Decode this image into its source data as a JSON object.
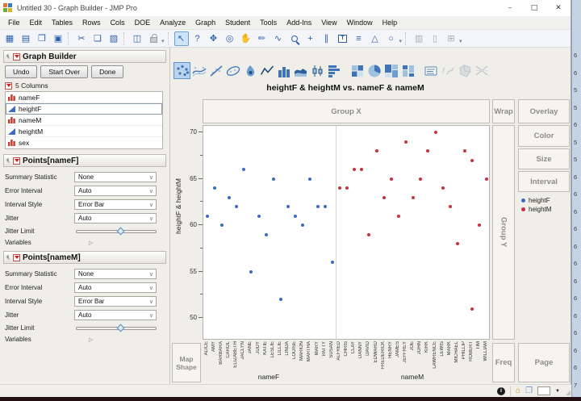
{
  "window": {
    "title": "Untitled 30 - Graph Builder - JMP Pro",
    "controls": [
      {
        "name": "minimize-button",
        "glyph": "–"
      },
      {
        "name": "maximize-button",
        "glyph": "□"
      },
      {
        "name": "close-button",
        "glyph": "✕"
      }
    ]
  },
  "menu": {
    "items": [
      "File",
      "Edit",
      "Tables",
      "Rows",
      "Cols",
      "DOE",
      "Analyze",
      "Graph",
      "Student",
      "Tools",
      "Add-Ins",
      "View",
      "Window",
      "Help"
    ]
  },
  "toolbar": {
    "groups": [
      [
        {
          "name": "new-data-table-icon",
          "glyph": "▦"
        },
        {
          "name": "new-journal-icon",
          "glyph": "▤"
        },
        {
          "name": "open-icon",
          "glyph": "❐"
        },
        {
          "name": "save-icon",
          "glyph": "▣"
        }
      ],
      [
        {
          "name": "cut-icon",
          "glyph": "✂"
        },
        {
          "name": "copy-icon",
          "glyph": "❏"
        },
        {
          "name": "paste-icon",
          "glyph": "▨"
        }
      ],
      [
        {
          "name": "script-window-icon",
          "glyph": "◫"
        },
        {
          "name": "lock-icon",
          "glyph": "",
          "css": "lock",
          "gray": true
        }
      ],
      [
        {
          "name": "arrow-tool-icon",
          "glyph": "↖",
          "selected": true
        },
        {
          "name": "help-tool-icon",
          "glyph": "?"
        },
        {
          "name": "grabber-tool-icon",
          "glyph": "✥"
        },
        {
          "name": "brush-tool-icon",
          "glyph": "◎"
        },
        {
          "name": "hand-tool-icon",
          "glyph": "✋"
        },
        {
          "name": "paintbrush-tool-icon",
          "glyph": "✏"
        },
        {
          "name": "lasso-tool-icon",
          "glyph": "∿"
        },
        {
          "name": "magnifier-tool-icon",
          "glyph": "",
          "css": "magnifier"
        },
        {
          "name": "crosshair-tool-icon",
          "glyph": "+"
        },
        {
          "name": "scroller-tool-icon",
          "glyph": "∥"
        },
        {
          "name": "annotate-tool-icon",
          "glyph": "T",
          "css": "annotate"
        },
        {
          "name": "line-annotate-tool-icon",
          "glyph": "≡"
        },
        {
          "name": "polygon-annotate-tool-icon",
          "glyph": "△"
        },
        {
          "name": "oval-annotate-tool-icon",
          "glyph": "○"
        }
      ],
      [
        {
          "name": "save-session-icon",
          "glyph": "▥",
          "gray": true
        },
        {
          "name": "columns-viewer-icon",
          "glyph": "▯",
          "gray": true
        },
        {
          "name": "add-icon",
          "glyph": "⊞",
          "gray": true
        }
      ]
    ]
  },
  "left_panel": {
    "header": "Graph Builder",
    "buttons": [
      {
        "name": "undo-button",
        "label": "Undo"
      },
      {
        "name": "start-over-button",
        "label": "Start Over"
      },
      {
        "name": "done-button",
        "label": "Done"
      }
    ],
    "columns_header": "5 Columns",
    "columns": [
      {
        "name": "nameF",
        "type": "nominal",
        "selected": false
      },
      {
        "name": "heightF",
        "type": "continuous",
        "selected": true
      },
      {
        "name": "nameM",
        "type": "nominal",
        "selected": false
      },
      {
        "name": "heightM",
        "type": "continuous",
        "selected": false
      },
      {
        "name": "sex",
        "type": "nominal",
        "selected": false
      }
    ],
    "panels": [
      {
        "title": "Points[nameF]",
        "rows": [
          {
            "label": "Summary Statistic",
            "value": "None"
          },
          {
            "label": "Error Interval",
            "value": "Auto"
          },
          {
            "label": "Interval Style",
            "value": "Error Bar"
          },
          {
            "label": "Jitter",
            "value": "Auto"
          }
        ],
        "slider_label": "Jitter Limit",
        "variables_label": "Variables"
      },
      {
        "title": "Points[nameM]",
        "rows": [
          {
            "label": "Summary Statistic",
            "value": "None"
          },
          {
            "label": "Error Interval",
            "value": "Auto"
          },
          {
            "label": "Interval Style",
            "value": "Error Bar"
          },
          {
            "label": "Jitter",
            "value": "Auto"
          }
        ],
        "slider_label": "Jitter Limit",
        "variables_label": "Variables"
      }
    ]
  },
  "gallery": {
    "items": [
      {
        "name": "points",
        "selected": true
      },
      {
        "name": "smoother"
      },
      {
        "name": "line-of-fit"
      },
      {
        "name": "ellipse"
      },
      {
        "name": "contour"
      },
      {
        "name": "line"
      },
      {
        "name": "bar"
      },
      {
        "name": "area"
      },
      {
        "name": "box-plot"
      },
      {
        "name": "histogram"
      },
      {
        "name": "heatmap",
        "gap_before": true
      },
      {
        "name": "pie"
      },
      {
        "name": "treemap"
      },
      {
        "name": "mosaic"
      },
      {
        "name": "caption-box",
        "gap_before": true
      },
      {
        "name": "formula",
        "disabled": true
      },
      {
        "name": "map-shapes",
        "disabled": true
      },
      {
        "name": "parallel",
        "disabled": true
      }
    ]
  },
  "chart": {
    "title": "heightF & heightM vs. nameF & nameM",
    "zones": {
      "group_x": "Group X",
      "wrap": "Wrap",
      "overlay": "Overlay",
      "color": "Color",
      "size": "Size",
      "interval": "Interval",
      "group_y": "Group Y",
      "map_shape": "Map Shape",
      "freq": "Freq",
      "page": "Page"
    },
    "legend": [
      {
        "label": "heightF",
        "color": "#3a6bc6"
      },
      {
        "label": "heightM",
        "color": "#c9313f"
      }
    ]
  },
  "chart_data": {
    "type": "scatter",
    "title": "heightF & heightM vs. nameF & nameM",
    "ylabel": "heightF & heightM",
    "yticks": [
      50,
      55,
      60,
      65,
      70
    ],
    "ylim": [
      49,
      71
    ],
    "x_groups": [
      {
        "xlabel": "nameF",
        "series": "heightF",
        "color": "#3a6bc6",
        "categories": [
          "ALICE",
          "AMY",
          "BARBARA",
          "CAROL",
          "ELIZABETH",
          "JACLYN",
          "JANE",
          "JUDY",
          "KATIE",
          "LESLIE",
          "LILLIE",
          "LINDA",
          "LOUISE",
          "MARION",
          "MARTHA",
          "MARY",
          "PATTY",
          "SUSAN"
        ],
        "values": [
          61,
          64,
          60,
          63,
          62,
          66,
          55,
          61,
          59,
          65,
          52,
          62,
          61,
          60,
          65,
          62,
          62,
          56
        ]
      },
      {
        "xlabel": "nameM",
        "series": "heightM",
        "color": "#c9313f",
        "categories": [
          "ALFRED",
          "CHRIS",
          "CLAY",
          "DANNY",
          "DAVID",
          "EDWARD",
          "FREDERICK",
          "HENRY",
          "JAMES",
          "JEFFREY",
          "JOE",
          "JOHN",
          "KIRK",
          "LAWRENCE",
          "LEWIS",
          "MARK",
          "MICHAEL",
          "PHILLIP",
          "ROBERT",
          "TIM",
          "WILLIAM"
        ],
        "values": [
          64,
          64,
          66,
          66,
          59,
          68,
          63,
          65,
          61,
          69,
          63,
          65,
          68,
          70,
          64,
          62,
          58,
          68,
          [
            67,
            51
          ],
          60,
          65
        ]
      }
    ]
  },
  "status_bar": {
    "icons": [
      {
        "name": "info-icon",
        "glyph": "i"
      },
      {
        "name": "home-icon",
        "glyph": "⌂"
      },
      {
        "name": "window-layout-icon",
        "glyph": "❐"
      },
      {
        "name": "zoom-selector",
        "caret": "▼"
      }
    ]
  },
  "background_window": {
    "digits": [
      "6",
      "6",
      "5",
      "5",
      "6",
      "5",
      "5",
      "6",
      "6",
      "6",
      "6",
      "6",
      "6",
      "6",
      "6",
      "6",
      "6",
      "6",
      "6",
      "7"
    ]
  }
}
